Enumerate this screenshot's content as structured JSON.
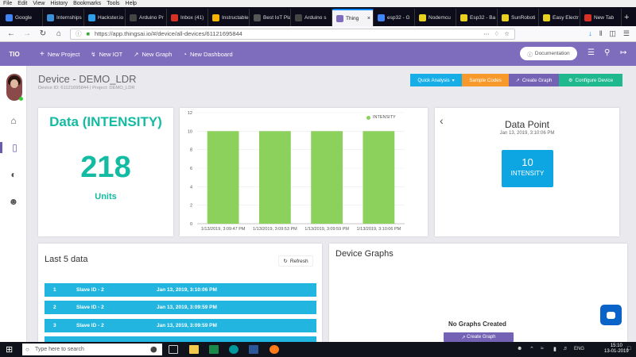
{
  "browser": {
    "menu": [
      "File",
      "Edit",
      "View",
      "History",
      "Bookmarks",
      "Tools",
      "Help"
    ],
    "tabs": [
      {
        "label": "Google",
        "color": "#4285f4"
      },
      {
        "label": "Internships",
        "color": "#3d8fd6"
      },
      {
        "label": "Hackster.io",
        "color": "#2e9fe8"
      },
      {
        "label": "Arduino Pr",
        "color": "#444444"
      },
      {
        "label": "Inbox (41)",
        "color": "#d93025"
      },
      {
        "label": "Instructable",
        "color": "#f4b400"
      },
      {
        "label": "Best IoT Platfo",
        "color": "#555555"
      },
      {
        "label": "Arduino s",
        "color": "#444444"
      },
      {
        "label": "Thing",
        "color": "#7e6cbc"
      },
      {
        "label": "esp32 - G",
        "color": "#4285f4"
      },
      {
        "label": "Nodemcu",
        "color": "#e8d21f"
      },
      {
        "label": "Esp32 - Ba",
        "color": "#e8d21f"
      },
      {
        "label": "SunRoboti",
        "color": "#e8d21f"
      },
      {
        "label": "Easy Electr",
        "color": "#e8d21f"
      },
      {
        "label": "New Tab",
        "color": "#d93025"
      }
    ],
    "active_tab": 8,
    "url": "https://app.thingsai.io/#/device/all-devices/61121695844"
  },
  "app": {
    "logo": "TIO",
    "nav": [
      {
        "label": "New Project",
        "icon": "plus-icon"
      },
      {
        "label": "New IOT",
        "icon": "bolt-icon"
      },
      {
        "label": "New Graph",
        "icon": "graph-icon"
      },
      {
        "label": "New Dashboard",
        "icon": "dashboard-icon"
      }
    ],
    "documentation": "Documentation",
    "header_color": "#7e6cbc"
  },
  "device": {
    "title": "Device - DEMO_LDR",
    "subtitle": "Device ID: 61121695844  |  Project: DEMO_LDR",
    "actions": [
      {
        "label": "Quick Analysis",
        "color": "#17aee8"
      },
      {
        "label": "Sample Codes",
        "color": "#f79a2b"
      },
      {
        "label": "Create Graph",
        "color": "#7463b5"
      },
      {
        "label": "Configure Device",
        "color": "#20b98f"
      }
    ]
  },
  "data_card": {
    "title": "Data (INTENSITY)",
    "value": "218",
    "unit": "Units"
  },
  "chart_data": {
    "type": "bar",
    "categories": [
      "1/13/2019, 3:09:47 PM",
      "1/13/2019, 3:09:53 PM",
      "1/13/2019, 3:09:59 PM",
      "1/13/2019, 3:10:06 PM"
    ],
    "series": [
      {
        "name": "INTENSITY",
        "values": [
          10,
          10,
          10,
          10
        ],
        "color": "#8bd15c"
      }
    ],
    "yticks": [
      0,
      2,
      4,
      6,
      8,
      10,
      12
    ],
    "ylim": [
      0,
      12
    ],
    "grid": true,
    "legend": "top-right"
  },
  "data_point": {
    "title": "Data Point",
    "date": "Jan 13, 2019, 3:10:06 PM",
    "value": "10",
    "label": "INTENSITY"
  },
  "last5": {
    "title": "Last 5 data",
    "refresh": "Refresh",
    "rows": [
      {
        "idx": "1",
        "slave": "Slave ID - 2",
        "time": "Jan 13, 2019, 3:10:06 PM"
      },
      {
        "idx": "2",
        "slave": "Slave ID - 2",
        "time": "Jan 13, 2019, 3:09:59 PM"
      },
      {
        "idx": "3",
        "slave": "Slave ID - 2",
        "time": "Jan 13, 2019, 3:09:59 PM"
      }
    ]
  },
  "graphs": {
    "title": "Device Graphs",
    "empty": "No Graphs Created",
    "create": "Create Graph"
  },
  "taskbar": {
    "search": "Type here to search",
    "lang": "ENG",
    "time": "15:10",
    "date": "13-01-2019"
  }
}
